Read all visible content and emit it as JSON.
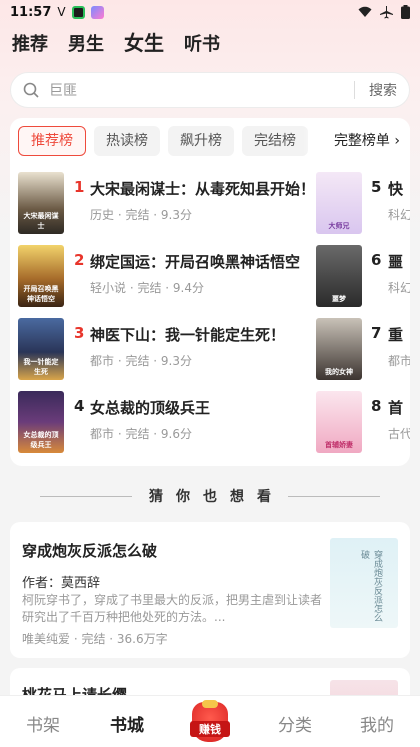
{
  "status_bar": {
    "time": "11:57",
    "carrier_mark": "V"
  },
  "top_tabs": [
    {
      "label": "推荐",
      "active": false
    },
    {
      "label": "男生",
      "active": false
    },
    {
      "label": "女生",
      "active": true
    },
    {
      "label": "听书",
      "active": false
    }
  ],
  "search": {
    "placeholder": "巨匪",
    "button": "搜索"
  },
  "rank": {
    "tabs": [
      "推荐榜",
      "热读榜",
      "飙升榜",
      "完结榜"
    ],
    "more_label": "完整榜单 ›",
    "books": [
      {
        "num": "1",
        "title": "大宋最闲谋士：从毒死知县开始！",
        "meta": "历史 · 完结 · 9.3分",
        "cover_text": "大宋最闲谋士"
      },
      {
        "num": "2",
        "title": "绑定国运：开局召唤黑神话悟空",
        "meta": "轻小说 · 完结 · 9.4分",
        "cover_text": "开局召唤黑神话悟空"
      },
      {
        "num": "3",
        "title": "神医下山：我一针能定生死！",
        "meta": "都市 · 完结 · 9.3分",
        "cover_text": "我一针能定生死"
      },
      {
        "num": "4",
        "title": "女总裁的顶级兵王",
        "meta": "都市 · 完结 · 9.6分",
        "cover_text": "女总裁的顶级兵王"
      }
    ],
    "books_col2": [
      {
        "num": "5",
        "title": "快",
        "meta": "科幻",
        "cover_text": "大师兄"
      },
      {
        "num": "6",
        "title": "噩",
        "meta": "科幻",
        "cover_text": "噩梦"
      },
      {
        "num": "7",
        "title": "重",
        "meta": "都市",
        "cover_text": "我的女神"
      },
      {
        "num": "8",
        "title": "首",
        "meta": "古代",
        "cover_text": "首辅娇妻"
      }
    ]
  },
  "guess": {
    "header": "猜你也想看"
  },
  "recommend": {
    "title": "穿成炮灰反派怎么破",
    "author": "作者：莫西辞",
    "desc": "柯阮穿书了，穿成了书里最大的反派，把男主虐到让读者研究出了千百万种把他处死的方法。...",
    "meta": "唯美纯爱 · 完结 · 36.6万字",
    "cover_text": "穿成炮灰反派怎么破"
  },
  "recommend2": {
    "title": "桃花马上请长缨"
  },
  "bottom_nav": {
    "items": [
      "书架",
      "书城",
      "分类",
      "我的"
    ],
    "earn_label": "赚钱",
    "active": "书城"
  },
  "colors": {
    "accent": "#e8352b",
    "active_tab_border": "#ee4a3c"
  }
}
